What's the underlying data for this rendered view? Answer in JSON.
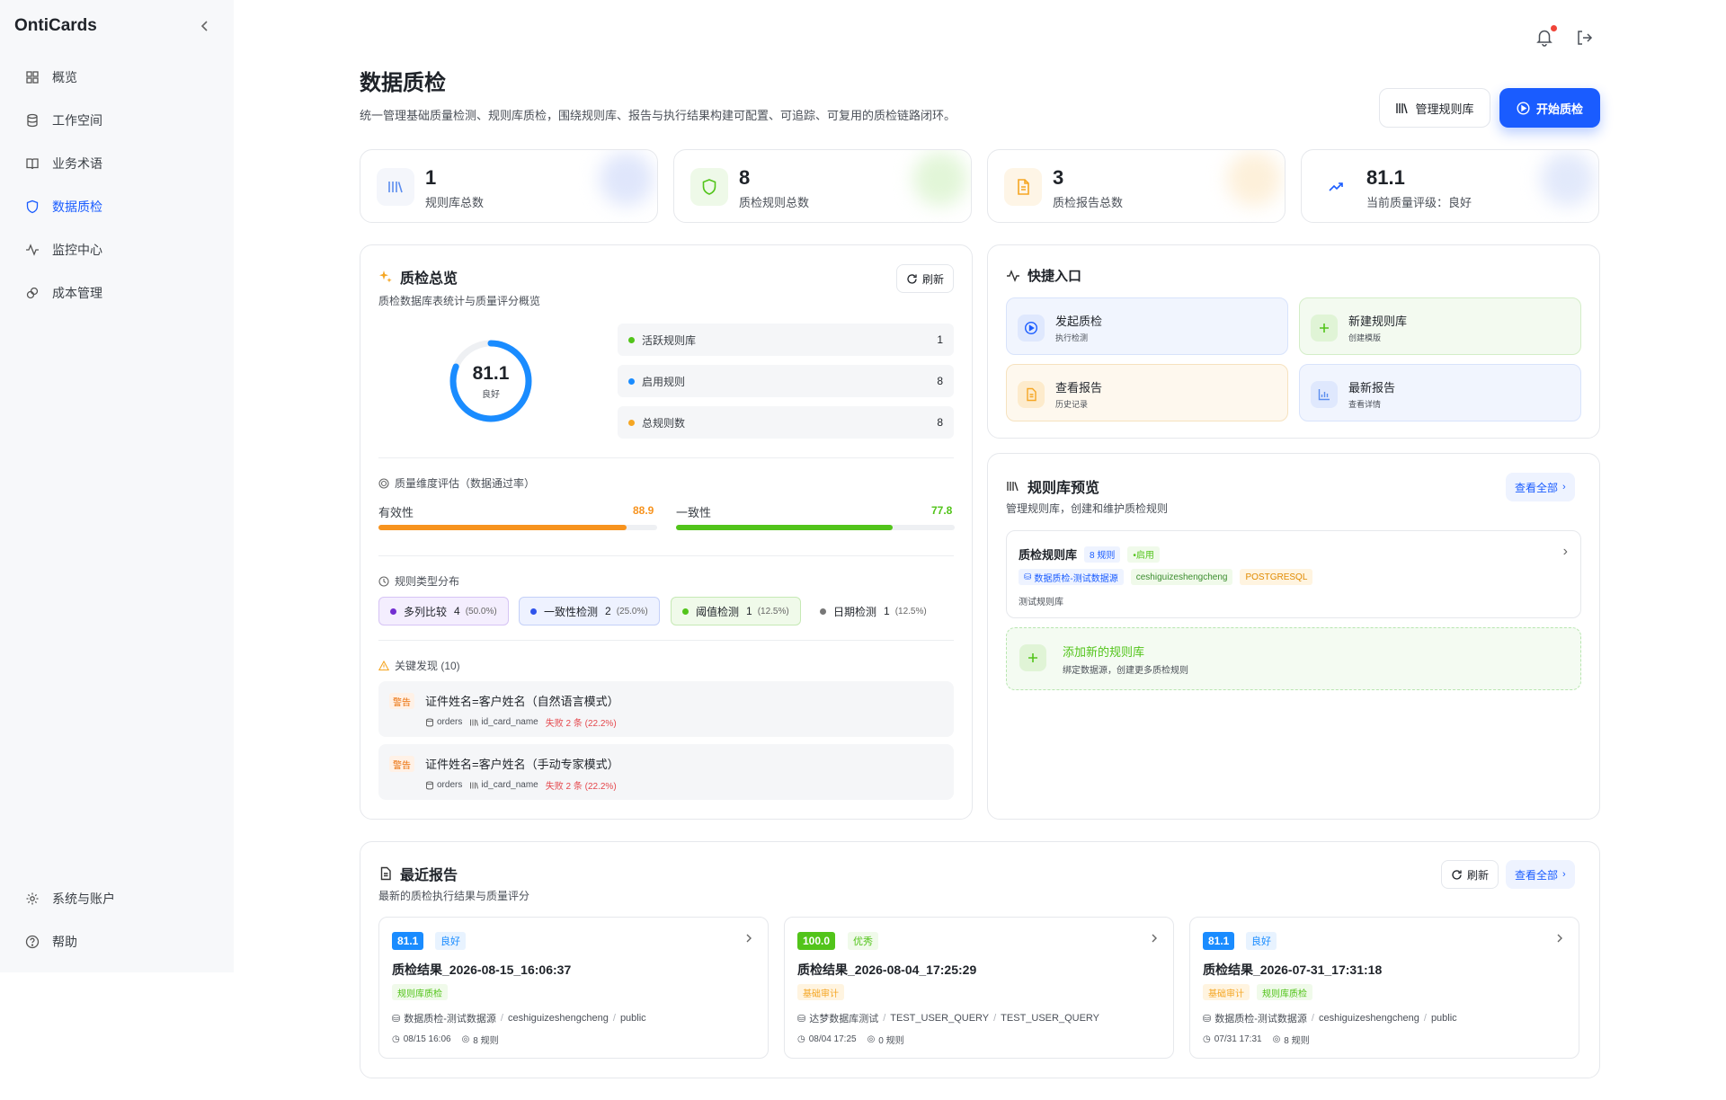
{
  "app": {
    "brand": "OntiCards"
  },
  "sidebar": {
    "items": [
      {
        "label": "概览",
        "icon": "grid-icon"
      },
      {
        "label": "工作空间",
        "icon": "database-icon"
      },
      {
        "label": "业务术语",
        "icon": "book-icon"
      },
      {
        "label": "数据质检",
        "icon": "shield-icon",
        "active": true
      },
      {
        "label": "监控中心",
        "icon": "activity-icon"
      },
      {
        "label": "成本管理",
        "icon": "link-icon"
      }
    ],
    "bottom": [
      {
        "label": "系统与账户",
        "icon": "gear-icon"
      },
      {
        "label": "帮助",
        "icon": "help-icon"
      }
    ]
  },
  "page": {
    "title": "数据质检",
    "subtitle": "统一管理基础质量检测、规则库质检，围绕规则库、报告与执行结果构建可配置、可追踪、可复用的质检链路闭环。",
    "manage_btn": "管理规则库",
    "start_btn": "开始质检"
  },
  "stats": [
    {
      "value": "1",
      "label": "规则库总数",
      "color": "#5b8def"
    },
    {
      "value": "8",
      "label": "质检规则总数",
      "color": "#52c41a"
    },
    {
      "value": "3",
      "label": "质检报告总数",
      "color": "#f5a623"
    },
    {
      "value": "81.1",
      "label": "当前质量评级：良好",
      "color": "#1a5cff"
    }
  ],
  "overview": {
    "title": "质检总览",
    "subtitle": "质检数据库表统计与质量评分概览",
    "refresh": "刷新",
    "score": "81.1",
    "score_fraction": 0.811,
    "score_label": "良好",
    "metrics": [
      {
        "label": "活跃规则库",
        "value": "1",
        "color": "#52c41a"
      },
      {
        "label": "启用规则",
        "value": "8",
        "color": "#1a8cff"
      },
      {
        "label": "总规则数",
        "value": "8",
        "color": "#f5a623"
      }
    ],
    "dimension_title": "质量维度评估（数据通过率）",
    "dimensions": [
      {
        "label": "有效性",
        "value": "88.9",
        "color": "#f7931e"
      },
      {
        "label": "一致性",
        "value": "77.8",
        "color": "#52c41a"
      }
    ],
    "type_title": "规则类型分布",
    "types": [
      {
        "label": "多列比较",
        "count": "4",
        "pct": "(50.0%)",
        "dot": "#722ed1",
        "bg": "#f4eefe",
        "border": "#d6c4f5"
      },
      {
        "label": "一致性检测",
        "count": "2",
        "pct": "(25.0%)",
        "dot": "#2f54eb",
        "bg": "#eef2ff",
        "border": "#c4d0f8"
      },
      {
        "label": "阈值检测",
        "count": "1",
        "pct": "(12.5%)",
        "dot": "#52c41a",
        "bg": "#f0faea",
        "border": "#c6e9b5"
      },
      {
        "label": "日期检测",
        "count": "1",
        "pct": "(12.5%)",
        "dot": "#777777",
        "bg": "#ffffff",
        "border": "#ffffff"
      }
    ],
    "findings_title": "关键发现 (10)",
    "findings": [
      {
        "level": "警告",
        "title": "证件姓名=客户姓名（自然语言模式）",
        "table": "orders",
        "column": "id_card_name",
        "fail": "失败 2 条 (22.2%)"
      },
      {
        "level": "警告",
        "title": "证件姓名=客户姓名（手动专家模式）",
        "table": "orders",
        "column": "id_card_name",
        "fail": "失败 2 条 (22.2%)"
      }
    ]
  },
  "quick": {
    "title": "快捷入口",
    "items": [
      {
        "title": "发起质检",
        "sub": "执行检测",
        "icon": "play-circle-icon",
        "bg": "#f1f5fe",
        "border": "#d8e3fb",
        "ibg": "#dfe8fd",
        "ic": "#1a5cff"
      },
      {
        "title": "新建规则库",
        "sub": "创建模版",
        "icon": "plus-icon",
        "bg": "#f3faf0",
        "border": "#d4eec8",
        "ibg": "#e0f4d6",
        "ic": "#52c41a"
      },
      {
        "title": "查看报告",
        "sub": "历史记录",
        "icon": "file-icon",
        "bg": "#fef8ee",
        "border": "#f6e2bf",
        "ibg": "#fdebcc",
        "ic": "#f5a623"
      },
      {
        "title": "最新报告",
        "sub": "查看详情",
        "icon": "bar-chart-icon",
        "bg": "#f1f5fe",
        "border": "#d8e3fb",
        "ibg": "#dfe8fd",
        "ic": "#5b8def"
      }
    ]
  },
  "libs": {
    "title": "规则库预览",
    "subtitle": "管理规则库，创建和维护质检规则",
    "view_all": "查看全部",
    "item": {
      "name": "质检规则库",
      "rule_count": "8 规则",
      "status": "•启用",
      "datasource": "数据质检-测试数据源",
      "schema": "ceshiguizeshengcheng",
      "db": "POSTGRESQL",
      "desc": "测试规则库"
    },
    "add_title": "添加新的规则库",
    "add_sub": "绑定数据源，创建更多质检规则"
  },
  "reports": {
    "title": "最近报告",
    "subtitle": "最新的质检执行结果与质量评分",
    "refresh": "刷新",
    "view_all": "查看全部",
    "items": [
      {
        "score": "81.1",
        "score_color": "#1a8cff",
        "level": "良好",
        "level_bg": "#e8f3ff",
        "level_color": "#1a8cff",
        "name": "质检结果_2026-08-15_16:06:37",
        "tags": [
          {
            "t": "规则库质检",
            "bg": "#f0faea",
            "c": "#52c41a"
          }
        ],
        "src": [
          "数据质检-测试数据源",
          "ceshiguizeshengcheng",
          "public"
        ],
        "time": "08/15 16:06",
        "rules": "8 规则"
      },
      {
        "score": "100.0",
        "score_color": "#52c41a",
        "level": "优秀",
        "level_bg": "#f0faea",
        "level_color": "#52c41a",
        "name": "质检结果_2026-08-04_17:25:29",
        "tags": [
          {
            "t": "基础审计",
            "bg": "#fff4e0",
            "c": "#f5a623"
          }
        ],
        "src": [
          "达梦数据库测试",
          "TEST_USER_QUERY",
          "TEST_USER_QUERY"
        ],
        "time": "08/04 17:25",
        "rules": "0 规则"
      },
      {
        "score": "81.1",
        "score_color": "#1a8cff",
        "level": "良好",
        "level_bg": "#e8f3ff",
        "level_color": "#1a8cff",
        "name": "质检结果_2026-07-31_17:31:18",
        "tags": [
          {
            "t": "基础审计",
            "bg": "#fff4e0",
            "c": "#f5a623"
          },
          {
            "t": "规则库质检",
            "bg": "#f0faea",
            "c": "#52c41a"
          }
        ],
        "src": [
          "数据质检-测试数据源",
          "ceshiguizeshengcheng",
          "public"
        ],
        "time": "07/31 17:31",
        "rules": "8 规则"
      }
    ]
  }
}
